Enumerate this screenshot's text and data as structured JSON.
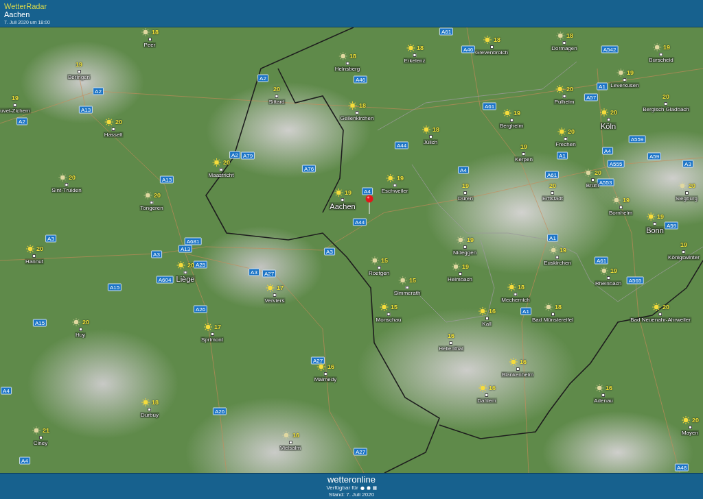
{
  "header": {
    "app_title": "WetterRadar",
    "location": "Aachen",
    "timestamp": "7. Juli 2020 um 18:00"
  },
  "map": {
    "cities": [
      {
        "name": "Peer",
        "temp": "18",
        "kind": "hazy",
        "major": false
      },
      {
        "name": "Beringen",
        "temp": "19",
        "kind": "plain",
        "major": false
      },
      {
        "name": "uvel-Zichem",
        "temp": "19",
        "kind": "plain",
        "major": false
      },
      {
        "name": "Hasselt",
        "temp": "20",
        "kind": "sun",
        "major": false
      },
      {
        "name": "Sint-Truiden",
        "temp": "20",
        "kind": "hazy",
        "major": false
      },
      {
        "name": "Tongeren",
        "temp": "20",
        "kind": "hazy",
        "major": false
      },
      {
        "name": "Maastricht",
        "temp": "20",
        "kind": "sun",
        "major": false
      },
      {
        "name": "Sittard",
        "temp": "20",
        "kind": "plain",
        "major": false
      },
      {
        "name": "Heinsberg",
        "temp": "18",
        "kind": "hazy",
        "major": false
      },
      {
        "name": "Geilenkirchen",
        "temp": "18",
        "kind": "sun",
        "major": false
      },
      {
        "name": "Aachen",
        "temp": "19",
        "kind": "sun",
        "major": true
      },
      {
        "name": "Erkelenz",
        "temp": "18",
        "kind": "sun",
        "major": false
      },
      {
        "name": "Grevenbroich",
        "temp": "18",
        "kind": "sun",
        "major": false
      },
      {
        "name": "Dormagen",
        "temp": "18",
        "kind": "hazy",
        "major": false
      },
      {
        "name": "Burscheid",
        "temp": "19",
        "kind": "hazy",
        "major": false
      },
      {
        "name": "Leverkusen",
        "temp": "19",
        "kind": "hazy",
        "major": false
      },
      {
        "name": "Pulheim",
        "temp": "20",
        "kind": "sun",
        "major": false
      },
      {
        "name": "Köln",
        "temp": "20",
        "kind": "sun",
        "major": true
      },
      {
        "name": "Bergisch Gladbach",
        "temp": "20",
        "kind": "plain",
        "major": false
      },
      {
        "name": "Bergheim",
        "temp": "19",
        "kind": "sun",
        "major": false
      },
      {
        "name": "Jülich",
        "temp": "18",
        "kind": "sun",
        "major": false
      },
      {
        "name": "Kerpen",
        "temp": "19",
        "kind": "plain",
        "major": false
      },
      {
        "name": "Frechen",
        "temp": "20",
        "kind": "sun",
        "major": false
      },
      {
        "name": "Eschweiler",
        "temp": "19",
        "kind": "sun",
        "major": false
      },
      {
        "name": "Düren",
        "temp": "19",
        "kind": "plain",
        "major": false
      },
      {
        "name": "Erftstadt",
        "temp": "20",
        "kind": "plain",
        "major": false
      },
      {
        "name": "Brühl",
        "temp": "20",
        "kind": "hazy",
        "major": false
      },
      {
        "name": "Siegburg",
        "temp": "20",
        "kind": "hazy",
        "major": false
      },
      {
        "name": "Bornheim",
        "temp": "19",
        "kind": "hazy",
        "major": false
      },
      {
        "name": "Bonn",
        "temp": "19",
        "kind": "sun",
        "major": true
      },
      {
        "name": "Nideggen",
        "temp": "19",
        "kind": "hazy",
        "major": false
      },
      {
        "name": "Königswinter",
        "temp": "19",
        "kind": "plain",
        "major": false
      },
      {
        "name": "Euskirchen",
        "temp": "19",
        "kind": "hazy",
        "major": false
      },
      {
        "name": "Rheinbach",
        "temp": "19",
        "kind": "hazy",
        "major": false
      },
      {
        "name": "Hannut",
        "temp": "20",
        "kind": "sun",
        "major": false
      },
      {
        "name": "Liège",
        "temp": "20",
        "kind": "sun",
        "major": true
      },
      {
        "name": "Verviers",
        "temp": "17",
        "kind": "sun",
        "major": false
      },
      {
        "name": "Huy",
        "temp": "20",
        "kind": "hazy",
        "major": false
      },
      {
        "name": "Sprimont",
        "temp": "17",
        "kind": "sun",
        "major": false
      },
      {
        "name": "Malmedy",
        "temp": "16",
        "kind": "sun",
        "major": false
      },
      {
        "name": "Durbuy",
        "temp": "18",
        "kind": "sun",
        "major": false
      },
      {
        "name": "Ciney",
        "temp": "21",
        "kind": "hazy",
        "major": false
      },
      {
        "name": "Vielsalm",
        "temp": "16",
        "kind": "hazy",
        "major": false
      },
      {
        "name": "Roetgen",
        "temp": "15",
        "kind": "hazy",
        "major": false
      },
      {
        "name": "Simmerath",
        "temp": "15",
        "kind": "hazy",
        "major": false
      },
      {
        "name": "Heimbach",
        "temp": "19",
        "kind": "hazy",
        "major": false
      },
      {
        "name": "Mechernich",
        "temp": "18",
        "kind": "sun",
        "major": false
      },
      {
        "name": "Monschau",
        "temp": "15",
        "kind": "sun",
        "major": false
      },
      {
        "name": "Kall",
        "temp": "16",
        "kind": "sun",
        "major": false
      },
      {
        "name": "Bad Münstereifel",
        "temp": "18",
        "kind": "hazy",
        "major": false
      },
      {
        "name": "Bad Neuenahr-Ahrweiler",
        "temp": "20",
        "kind": "sun",
        "major": false
      },
      {
        "name": "Hellenthal",
        "temp": "16",
        "kind": "plain",
        "major": false
      },
      {
        "name": "Blankenheim",
        "temp": "16",
        "kind": "sun",
        "major": false
      },
      {
        "name": "Dahlem",
        "temp": "16",
        "kind": "sun",
        "major": false
      },
      {
        "name": "Adenau",
        "temp": "16",
        "kind": "hazy",
        "major": false
      },
      {
        "name": "Mayen",
        "temp": "20",
        "kind": "sun",
        "major": false
      }
    ],
    "roads": [
      "A2",
      "A13",
      "A2",
      "A2",
      "A46",
      "A61",
      "A46",
      "A542",
      "A1",
      "A57",
      "A61",
      "A44",
      "A2",
      "A79",
      "A76",
      "A13",
      "A4",
      "A1",
      "A61",
      "A555",
      "A4",
      "A559",
      "A59",
      "A3",
      "A553",
      "A4",
      "A44",
      "A59",
      "A3",
      "A3",
      "A681",
      "A13",
      "A25",
      "A3",
      "A27",
      "A3",
      "A604",
      "A15",
      "A1",
      "A61",
      "A565",
      "A26",
      "A15",
      "A1",
      "A27",
      "A26",
      "A4",
      "A4",
      "A27",
      "A48"
    ]
  },
  "footer": {
    "logo": "wetteronline",
    "availability": "Verfügbar für",
    "updated": "Stand: 7. Juli 2020"
  }
}
